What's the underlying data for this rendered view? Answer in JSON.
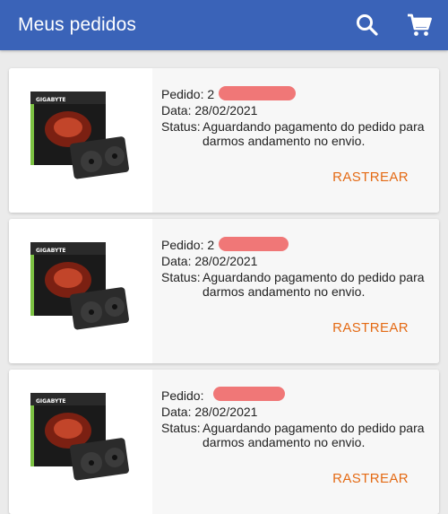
{
  "header": {
    "title": "Meus pedidos",
    "search_icon": "search-icon",
    "cart_icon": "cart-icon",
    "background": "#3a63b8"
  },
  "labels": {
    "pedido": "Pedido:",
    "data": "Data:",
    "status": "Status:",
    "track": "RASTREAR"
  },
  "orders": [
    {
      "order_prefix": "2",
      "date": "28/02/2021",
      "status": "Aguardando pagamento do pedido para darmos andamento no envio.",
      "product_icon": "graphics-card-image"
    },
    {
      "order_prefix": "2",
      "date": "28/02/2021",
      "status": "Aguardando pagamento do pedido para darmos andamento no envio.",
      "product_icon": "graphics-card-image"
    },
    {
      "order_prefix": "",
      "date": "28/02/2021",
      "status": "Aguardando pagamento do pedido para darmos andamento no envio.",
      "product_icon": "graphics-card-image"
    }
  ],
  "colors": {
    "accent": "#e46a14",
    "redaction": "#ef6b6b"
  }
}
